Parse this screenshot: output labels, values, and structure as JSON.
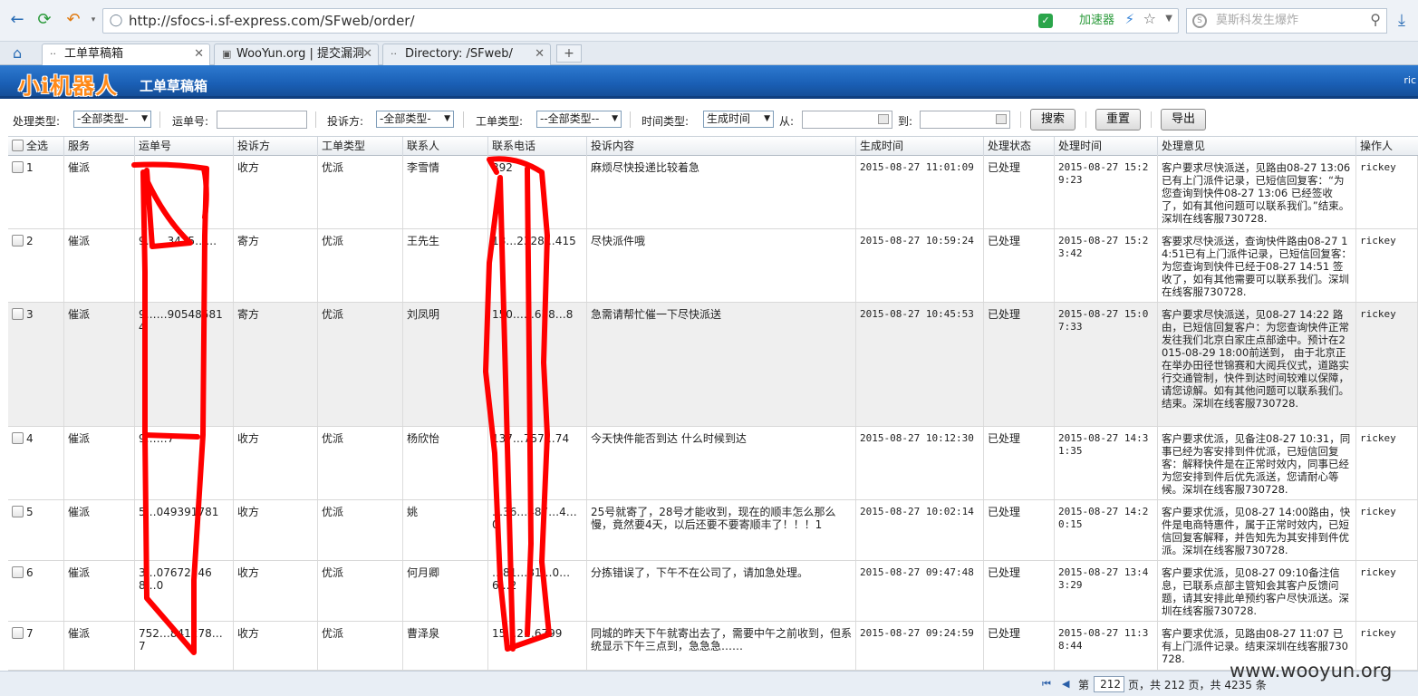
{
  "browser": {
    "url": "http://sfocs-i.sf-express.com/SFweb/order/",
    "accelerator": "加速器",
    "search_placeholder": "莫斯科发生爆炸",
    "tabs": [
      {
        "label": "工单草稿箱",
        "active": true
      },
      {
        "label": "WooYun.org | 提交漏洞",
        "active": false
      },
      {
        "label": "Directory: /SFweb/",
        "active": false
      }
    ],
    "new_tab": "+"
  },
  "app": {
    "logo": "小i机器人",
    "title": "工单草稿箱",
    "user": "ric"
  },
  "filters": {
    "process_type_label": "处理类型:",
    "process_type_value": "-全部类型-",
    "waybill_label": "运单号:",
    "complainant_label": "投诉方:",
    "complainant_value": "-全部类型-",
    "order_type_label": "工单类型:",
    "order_type_value": "--全部类型--",
    "time_type_label": "时间类型:",
    "time_type_value": "生成时间",
    "from_label": "从:",
    "to_label": "到:",
    "search_btn": "搜索",
    "reset_btn": "重置",
    "export_btn": "导出"
  },
  "table": {
    "headers": [
      "全选",
      "服务",
      "运单号",
      "投诉方",
      "工单类型",
      "联系人",
      "联系电话",
      "投诉内容",
      "生成时间",
      "处理状态",
      "处理时间",
      "处理意见",
      "操作人"
    ],
    "rows": [
      {
        "no": "1",
        "service": "催派",
        "waybill": "",
        "party": "收方",
        "type": "优派",
        "contact": "李雪情",
        "phone": "392",
        "content": "麻烦尽快投递比较着急",
        "created": "2015-08-27 11:01:09",
        "status": "已处理",
        "handled": "2015-08-27 15:29:23",
        "opinion": "客户要求尽快派送，见路由08-27 13:06已有上门派件记录，已短信回复客：“为您查询到快件08-27 13:06 已经签收了，如有其他问题可以联系我们。”结束。深圳在线客服730728.",
        "operator": "rickey"
      },
      {
        "no": "2",
        "service": "催派",
        "waybill": "9……3475……",
        "party": "寄方",
        "type": "优派",
        "contact": "王先生",
        "phone": "18…2328…415",
        "content": "尽快派件哦",
        "created": "2015-08-27 10:59:24",
        "status": "已处理",
        "handled": "2015-08-27 15:23:42",
        "opinion": "客要求尽快派送，查询快件路由08-27 14:51已有上门派件记录，已短信回复客：为您查询到快件已经于08-27 14:51 签收了，如有其他需要可以联系我们。深圳在线客服730728.",
        "operator": "rickey"
      },
      {
        "no": "3",
        "service": "催派",
        "waybill": "9……905485814",
        "party": "寄方",
        "type": "优派",
        "contact": "刘凤明",
        "phone": "150……638…8",
        "content": "急需请帮忙催一下尽快派送",
        "created": "2015-08-27 10:45:53",
        "status": "已处理",
        "handled": "2015-08-27 15:07:33",
        "opinion": "客户要求尽快派送，见08-27 14:22 路由，已短信回复客户：为您查询快件正常发往我们北京白家庄点部途中。预计在2015-08-29 18:00前送到， 由于北京正在举办田径世锦赛和大阅兵仪式，道路实行交通管制，快件到达时间较难以保障，请您谅解。如有其他问题可以联系我们。结束。深圳在线客服730728.",
        "operator": "rickey"
      },
      {
        "no": "4",
        "service": "催派",
        "waybill": "9……7",
        "party": "收方",
        "type": "优派",
        "contact": "杨欣怡",
        "phone": "137…757…74",
        "content": "今天快件能否到达 什么时候到达",
        "created": "2015-08-27 10:12:30",
        "status": "已处理",
        "handled": "2015-08-27 14:31:35",
        "opinion": "客户要求优派，见备注08-27 10:31，同事已经为客安排到件优派，已短信回复客：解释快件是在正常时效内，同事已经为您安排到件后优先派送，您请耐心等候。深圳在线客服730728.",
        "operator": "rickey"
      },
      {
        "no": "5",
        "service": "催派",
        "waybill": "5…049391781",
        "party": "收方",
        "type": "优派",
        "contact": "姚",
        "phone": "…36…487…4…0",
        "content": "25号就寄了，28号才能收到，现在的顺丰怎么那么慢，竟然要4天，以后还要不要寄顺丰了！！！1",
        "created": "2015-08-27 10:02:14",
        "status": "已处理",
        "handled": "2015-08-27 14:20:15",
        "opinion": "客户要求优派，见08-27 14:00路由，快件是电商特惠件，属于正常时效内，已短信回复客解释，并告知先为其安排到件优派。深圳在线客服730728.",
        "operator": "rickey"
      },
      {
        "no": "6",
        "service": "催派",
        "waybill": "3…076723468…0",
        "party": "收方",
        "type": "优派",
        "contact": "何月卿",
        "phone": "…81…81…0…6…2",
        "content": "分拣错误了，下午不在公司了，请加急处理。",
        "created": "2015-08-27 09:47:48",
        "status": "已处理",
        "handled": "2015-08-27 13:43:29",
        "opinion": "客户要求优派，见08-27 09:10备注信息，已联系点部主管知会其客户反馈问题，请其安排此单预约客户尽快派送。深圳在线客服730728.",
        "operator": "rickey"
      },
      {
        "no": "7",
        "service": "催派",
        "waybill": "752…841278…7",
        "party": "收方",
        "type": "优派",
        "contact": "曹泽泉",
        "phone": "15…2…6799",
        "content": "同城的昨天下午就寄出去了，需要中午之前收到，但系统显示下午三点到，急急急……",
        "created": "2015-08-27 09:24:59",
        "status": "已处理",
        "handled": "2015-08-27 11:38:44",
        "opinion": "客户要求优派，见路由08-27 11:07 已有上门派件记录。结束深圳在线客服730728.",
        "operator": "rickey"
      }
    ]
  },
  "pager": {
    "prefix": "第",
    "page": "212",
    "summary": "页，共 212 页，共 4235 条"
  },
  "watermark": "www.wooyun.org"
}
